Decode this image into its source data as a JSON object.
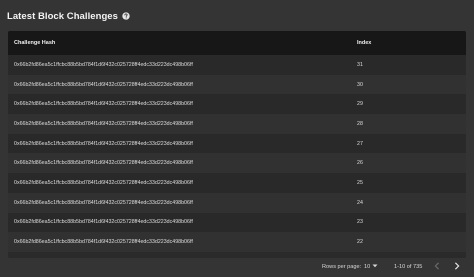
{
  "header": {
    "title": "Latest Block Challenges",
    "help_icon": "help-circle-icon"
  },
  "table": {
    "columns": [
      "Challenge Hash",
      "Index"
    ],
    "rows": [
      {
        "hash": "0x66b2fd86ea5c1ffcbc88b5bd784f1d6f432c025728ff4edc33d223dc498b06ff",
        "index": "31"
      },
      {
        "hash": "0x66b2fd86ea5c1ffcbc88b5bd784f1d6f432c025728ff4edc33d223dc498b06ff",
        "index": "30"
      },
      {
        "hash": "0x66b2fd86ea5c1ffcbc88b5bd784f1d6f432c025728ff4edc33d223dc498b06ff",
        "index": "29"
      },
      {
        "hash": "0x66b2fd86ea5c1ffcbc88b5bd784f1d6f432c025728ff4edc33d223dc498b06ff",
        "index": "28"
      },
      {
        "hash": "0x66b2fd86ea5c1ffcbc88b5bd784f1d6f432c025728ff4edc33d223dc498b06ff",
        "index": "27"
      },
      {
        "hash": "0x66b2fd86ea5c1ffcbc88b5bd784f1d6f432c025728ff4edc33d223dc498b06ff",
        "index": "26"
      },
      {
        "hash": "0x66b2fd86ea5c1ffcbc88b5bd784f1d6f432c025728ff4edc33d223dc498b06ff",
        "index": "25"
      },
      {
        "hash": "0x66b2fd86ea5c1ffcbc88b5bd784f1d6f432c025728ff4edc33d223dc498b06ff",
        "index": "24"
      },
      {
        "hash": "0x66b2fd86ea5c1ffcbc88b5bd784f1d6f432c025728ff4edc33d223dc498b06ff",
        "index": "23"
      },
      {
        "hash": "0x66b2fd86ea5c1ffcbc88b5bd784f1d6f432c025728ff4edc33d223dc498b06ff",
        "index": "22"
      }
    ]
  },
  "pagination": {
    "rows_per_page_label": "Rows per page:",
    "rows_per_page_value": "10",
    "range_label": "1-10 of 735",
    "prev_icon": "chevron-left-icon",
    "next_icon": "chevron-right-icon"
  },
  "colors": {
    "background": "#343434",
    "header_bg": "#171717",
    "row_bg": "#292929",
    "row_alt_bg": "#313131"
  }
}
